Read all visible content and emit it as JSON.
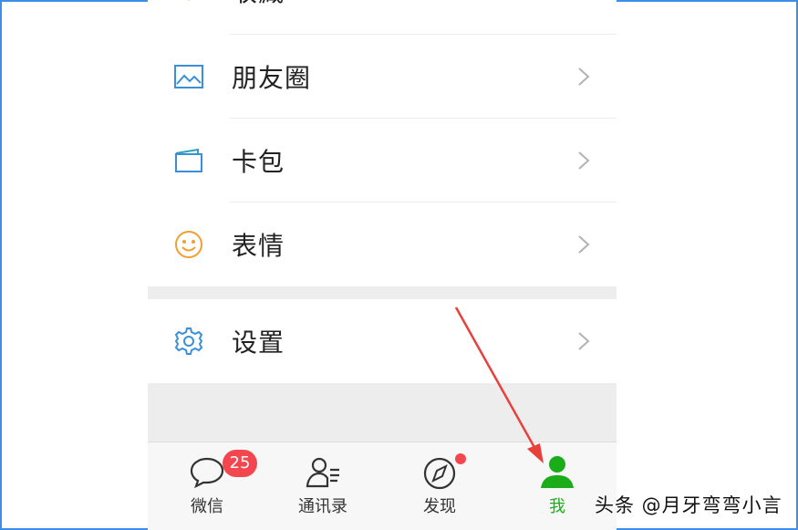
{
  "menu": {
    "items": [
      {
        "label": "朋友圈",
        "icon": "moments-picture-icon"
      },
      {
        "label": "卡包",
        "icon": "card-wallet-icon"
      },
      {
        "label": "表情",
        "icon": "smiley-icon"
      }
    ],
    "settings": {
      "label": "设置",
      "icon": "settings-gear-icon"
    },
    "partial_top_label": "收藏"
  },
  "tabbar": {
    "tabs": [
      {
        "label": "微信",
        "badge": "25",
        "icon": "chat-bubble-icon"
      },
      {
        "label": "通讯录",
        "icon": "contacts-icon"
      },
      {
        "label": "发现",
        "icon": "compass-icon",
        "has_dot": true
      },
      {
        "label": "我",
        "icon": "me-person-icon",
        "active": true
      }
    ]
  },
  "watermark": "头条 @月牙弯弯小言",
  "colors": {
    "accent_green": "#1aad19",
    "badge_red": "#f4464e",
    "icon_blue": "#3a8fd8",
    "smiley_orange": "#f0a030",
    "annotation_arrow": "#e8403a",
    "frame_border": "#3d8ee8"
  }
}
